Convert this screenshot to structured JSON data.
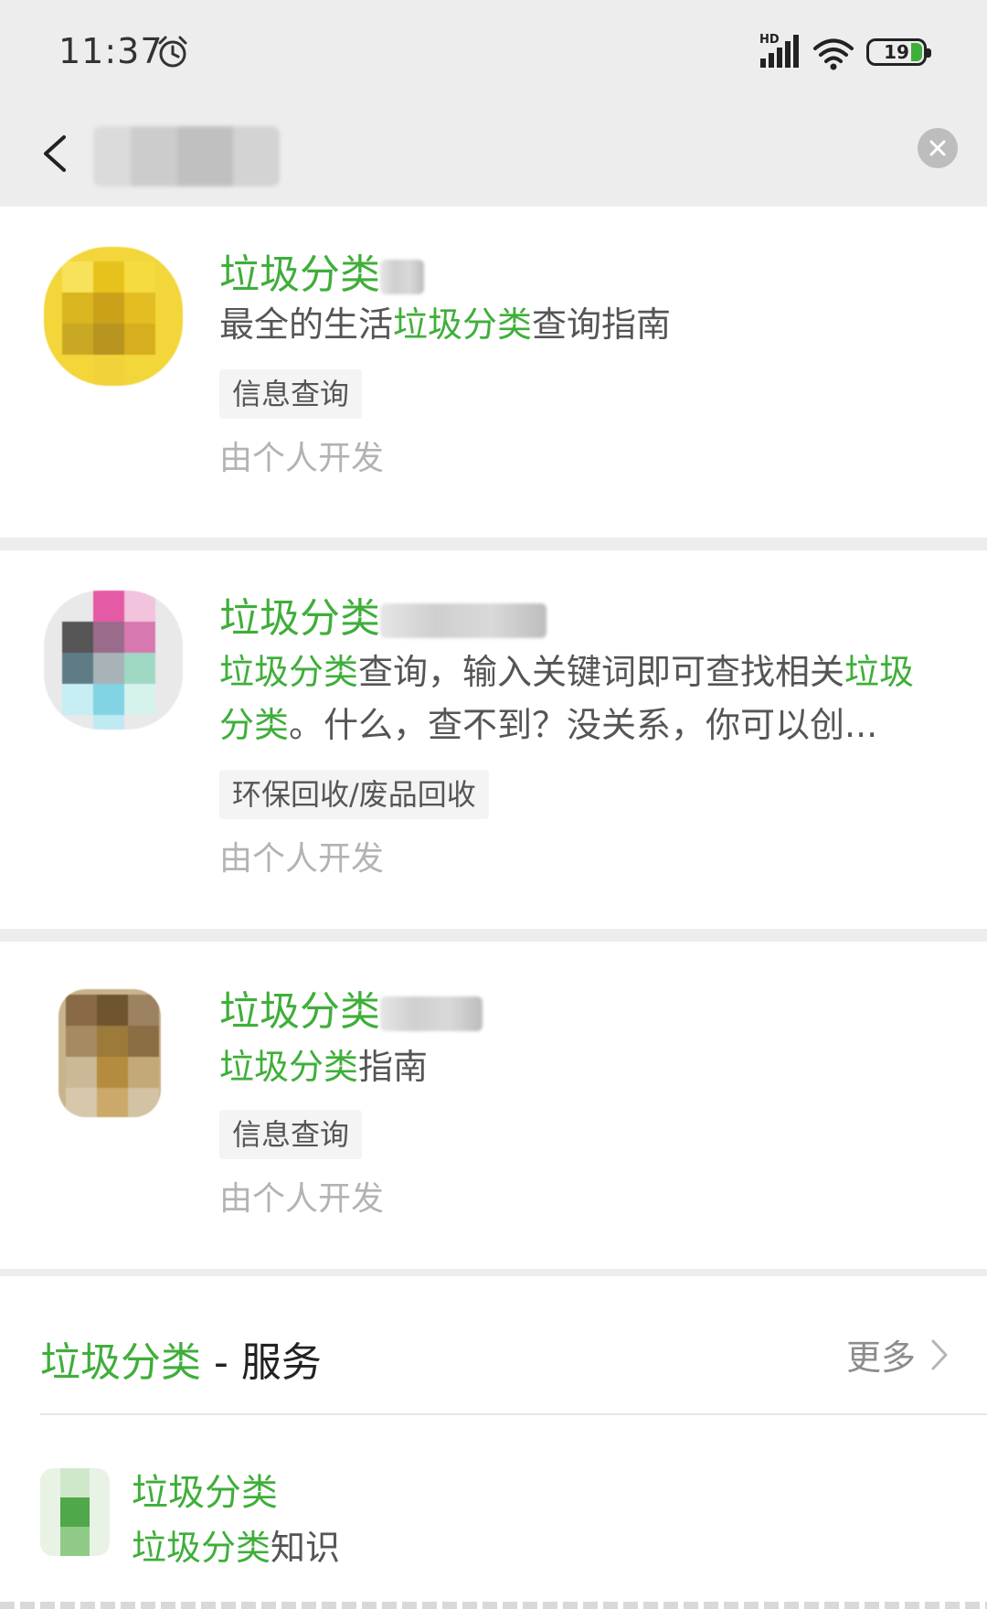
{
  "status_bar": {
    "time": "11:37",
    "network": "HD",
    "battery": "19"
  },
  "results": [
    {
      "title": "垃圾分类",
      "desc": [
        {
          "t": "最全的生活",
          "hl": false
        },
        {
          "t": "垃圾分类",
          "hl": true
        },
        {
          "t": "查询指南",
          "hl": false
        }
      ],
      "tag": "信息查询",
      "developer": "由个人开发"
    },
    {
      "title": "垃圾分类",
      "desc": [
        {
          "t": "垃圾分类",
          "hl": true
        },
        {
          "t": "查询，输入关键词即可查找相关",
          "hl": false
        },
        {
          "t": "垃圾分类",
          "hl": true
        },
        {
          "t": "。什么，查不到？没关系，你可以创...",
          "hl": false
        }
      ],
      "tag": "环保回收/废品回收",
      "developer": "由个人开发"
    },
    {
      "title": "垃圾分类",
      "desc": [
        {
          "t": "垃圾分类",
          "hl": true
        },
        {
          "t": "指南",
          "hl": false
        }
      ],
      "tag": "信息查询",
      "developer": "由个人开发"
    }
  ],
  "services": {
    "keyword": "垃圾分类",
    "suffix": " - 服务",
    "more": "更多",
    "item": {
      "name": "垃圾分类",
      "desc_hl": "垃圾分类",
      "desc_rest": "知识"
    }
  },
  "colors": {
    "highlight": "#3fae3a",
    "background": "#ededed"
  }
}
